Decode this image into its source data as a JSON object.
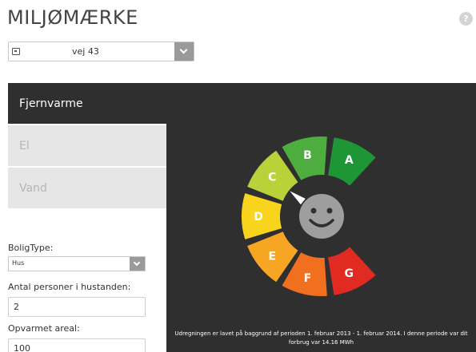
{
  "header": {
    "title": "MILJØMÆRKE",
    "help_label": "?"
  },
  "address": {
    "value": "vej 43",
    "icon": "home-icon"
  },
  "tabs": [
    {
      "label": "Fjernvarme",
      "active": true
    },
    {
      "label": "El",
      "active": false
    },
    {
      "label": "Vand",
      "active": false
    }
  ],
  "form": {
    "housing_type_label": "BoligType:",
    "housing_type_value": "Hus",
    "persons_label": "Antal personer i hustanden:",
    "persons_value": "2",
    "area_label": "Opvarmet areal:",
    "area_value": "100"
  },
  "gauge": {
    "rating": "C",
    "face_icon": "smiley-icon",
    "segments": [
      {
        "label": "G",
        "color": "#e02a22"
      },
      {
        "label": "F",
        "color": "#f07020"
      },
      {
        "label": "E",
        "color": "#f6a623"
      },
      {
        "label": "D",
        "color": "#f8d41c"
      },
      {
        "label": "C",
        "color": "#b9d23a"
      },
      {
        "label": "B",
        "color": "#4dae3f"
      },
      {
        "label": "A",
        "color": "#1e9636"
      }
    ],
    "summary": "Udregningen er lavet på baggrund af perioden 1. februar 2013 - 1. februar 2014. I denne periode var dit forbrug var 14.16 MWh"
  },
  "colors": {
    "panel_bg": "#2f2f2f",
    "tab_inactive": "#e6e6e6",
    "tab_inactive_text": "#b5b5b5",
    "face": "#9e9e9e"
  }
}
